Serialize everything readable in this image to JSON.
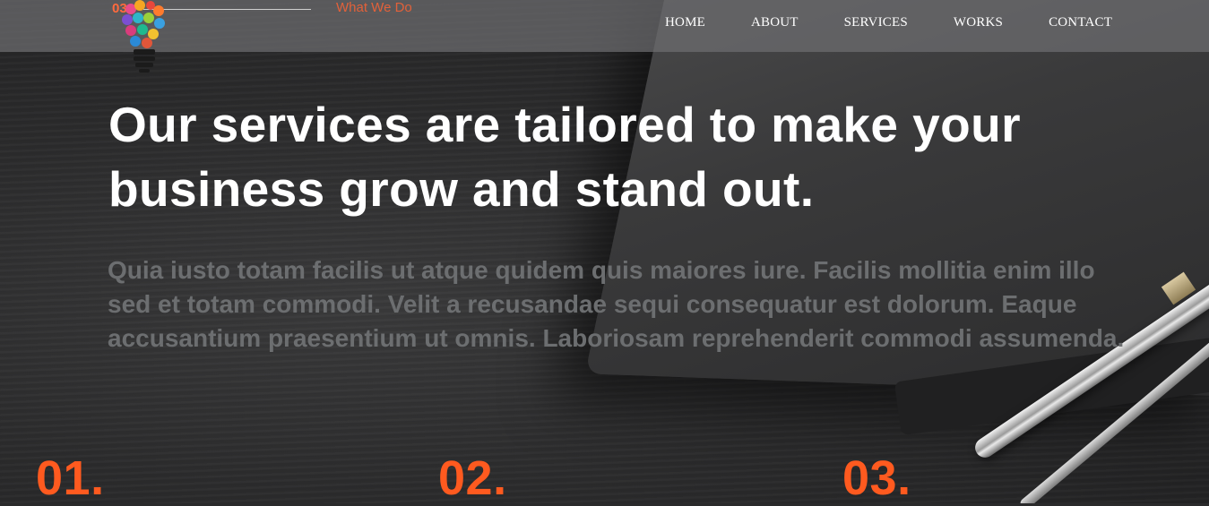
{
  "header": {
    "section_number": "03",
    "section_title": "What We Do",
    "nav": [
      {
        "label": "HOME"
      },
      {
        "label": "ABOUT"
      },
      {
        "label": "SERVICES"
      },
      {
        "label": "WORKS"
      },
      {
        "label": "CONTACT"
      }
    ]
  },
  "hero": {
    "headline": "Our services are tailored to make your business grow and stand out.",
    "description": "Quia iusto totam facilis ut atque quidem quis maiores iure. Facilis mollitia enim illo sed et totam commodi. Velit a recusandae sequi consequatur est dolorum. Eaque accusantium praesentium ut omnis. Laboriosam reprehenderit commodi assumenda."
  },
  "steps": [
    {
      "number": "01."
    },
    {
      "number": "02."
    },
    {
      "number": "03."
    }
  ],
  "colors": {
    "accent": "#ff5a1f",
    "headline": "#ffffff",
    "muted_text": "#6c6e70",
    "header_bg": "#6e6e70"
  },
  "icons": {
    "logo": "lightbulb-logo-icon"
  }
}
